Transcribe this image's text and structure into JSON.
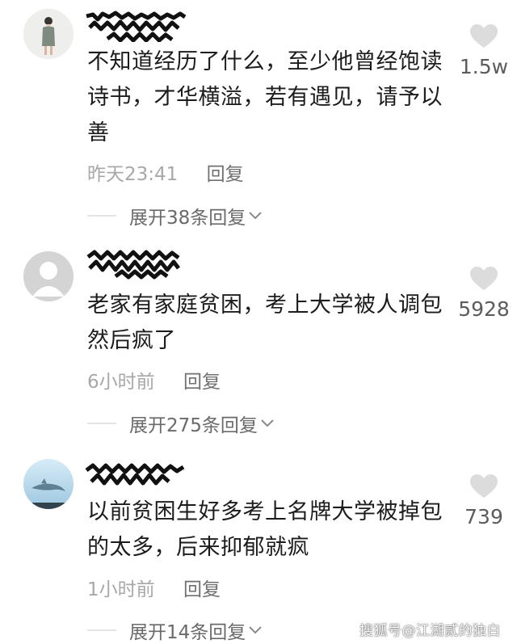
{
  "comments": [
    {
      "avatar": "woman-photo-avatar",
      "text": "不知道经历了什么，至少他曾经饱读诗书，才华横溢，若有遇见，请予以善",
      "time": "昨天23:41",
      "reply": "回复",
      "expand": "展开38条回复",
      "likes": "1.5w"
    },
    {
      "avatar": "default-avatar",
      "text": "老家有家庭贫困，考上大学被人调包然后疯了",
      "time": "6小时前",
      "reply": "回复",
      "expand": "展开275条回复",
      "likes": "5928"
    },
    {
      "avatar": "dolphin-avatar",
      "text": "以前贫困生好多考上名牌大学被掉包的太多，后来抑郁就疯",
      "time": "1小时前",
      "reply": "回复",
      "expand": "展开14条回复",
      "likes": "739"
    }
  ],
  "watermark": "搜狐号@江湖贰的独白"
}
